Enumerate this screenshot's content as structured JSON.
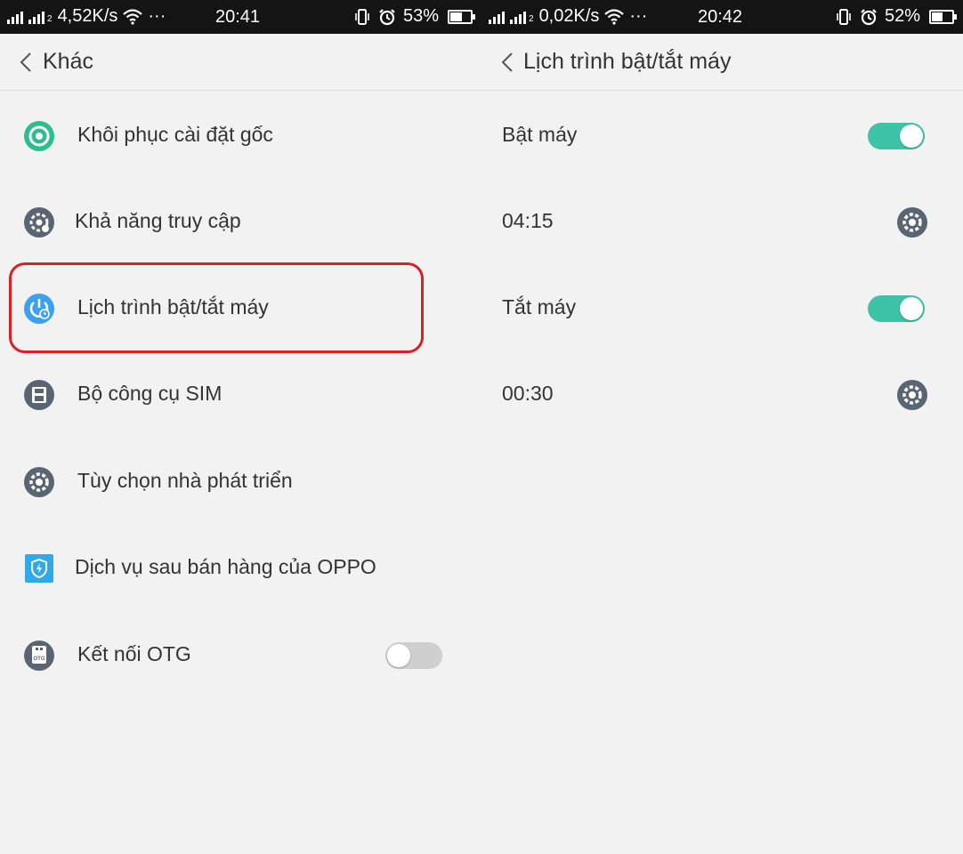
{
  "left": {
    "status": {
      "network_speed": "4,52K/s",
      "dots": "···",
      "time": "20:41",
      "battery": "53%",
      "battery_level": 0.53
    },
    "header": {
      "title": "Khác"
    },
    "items": [
      {
        "label": "Khôi phục cài đặt gốc"
      },
      {
        "label": "Khả năng truy cập"
      },
      {
        "label": "Lịch trình bật/tắt máy"
      },
      {
        "label": "Bộ công cụ SIM"
      },
      {
        "label": "Tùy chọn nhà phát triển"
      },
      {
        "label": "Dịch vụ sau bán hàng của OPPO"
      },
      {
        "label": "Kết nối OTG",
        "toggle_on": false
      }
    ]
  },
  "right": {
    "status": {
      "network_speed": "0,02K/s",
      "dots": "···",
      "time": "20:42",
      "battery": "52%",
      "battery_level": 0.52
    },
    "header": {
      "title": "Lịch trình bật/tắt máy"
    },
    "items": [
      {
        "label": "Bật máy",
        "toggle_on": true
      },
      {
        "label": "04:15"
      },
      {
        "label": "Tắt máy",
        "toggle_on": true
      },
      {
        "label": "00:30"
      }
    ]
  },
  "colors": {
    "accent": "#3dc4a8",
    "highlight": "#d62128",
    "icon_gray": "#5a6573",
    "icon_blue": "#3aa0f0",
    "status_bg": "#141414"
  }
}
